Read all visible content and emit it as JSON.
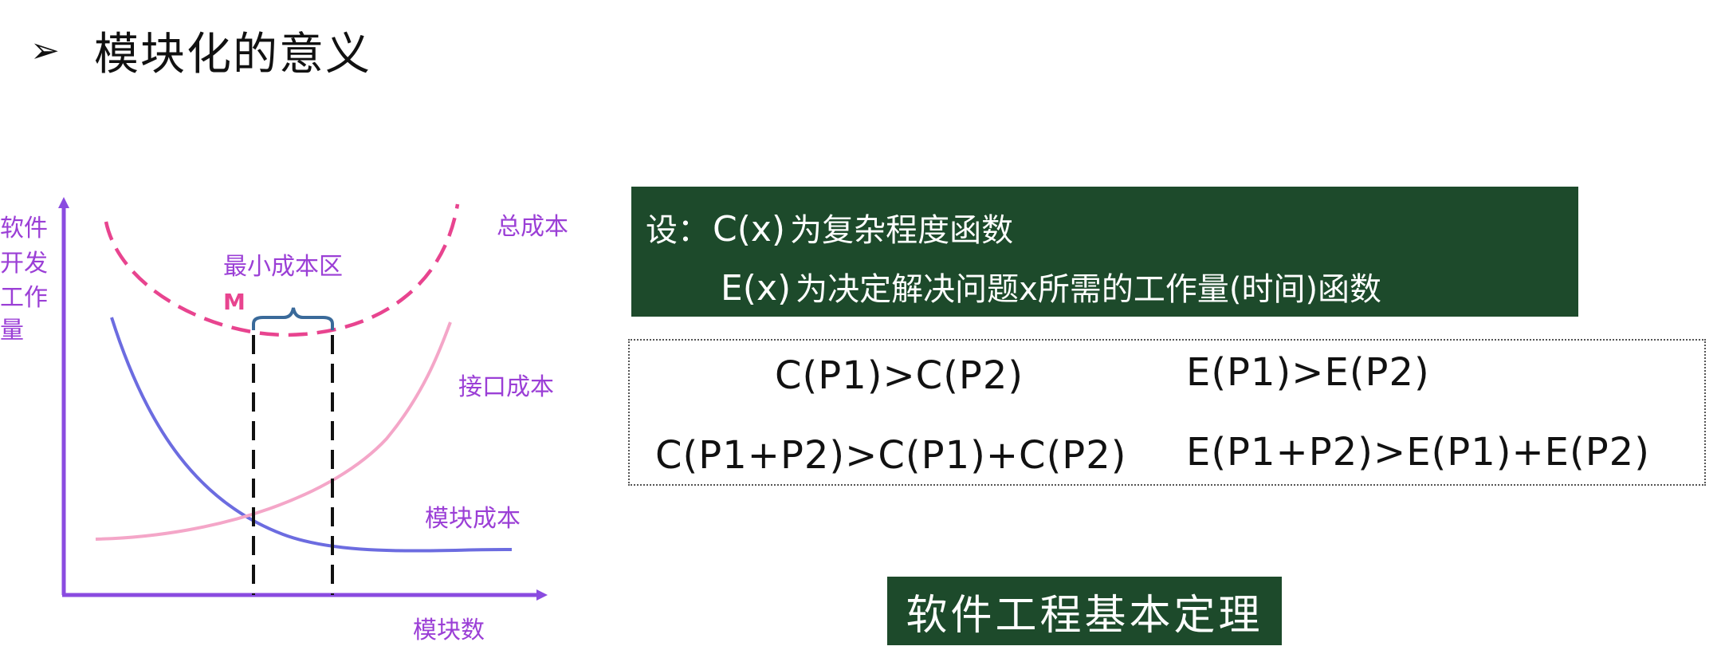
{
  "title": {
    "bullet": "➢",
    "text": "模块化的意义"
  },
  "diagram": {
    "y_axis_label": [
      "软件",
      "开发",
      "工作",
      "量"
    ],
    "x_axis_label": "模块数",
    "curves": {
      "total": "总成本",
      "interface": "接口成本",
      "module": "模块成本"
    },
    "min_region_label": "最小成本区",
    "m_marker": "M",
    "colors": {
      "axis": "#8a4be0",
      "total": "#e8448f",
      "interface": "#f4a6c8",
      "module": "#6c6ce0",
      "labels": "#9b3fd6",
      "brace": "#3a6a9a"
    }
  },
  "definitions": {
    "line1": {
      "prefix": "设：",
      "func": "C(x)",
      "text": "为复杂程度函数"
    },
    "line2": {
      "func": "E(x)",
      "text": "为决定解决问题x所需的工作量(时间)函数"
    }
  },
  "inequalities": {
    "row1_left": "C(P1)>C(P2)",
    "row1_right": "E(P1)>E(P2)",
    "row2_left": "C(P1+P2)>C(P1)+C(P2)",
    "row2_right": "E(P1+P2)>E(P1)+E(P2)"
  },
  "law_label": "软件工程基本定理"
}
